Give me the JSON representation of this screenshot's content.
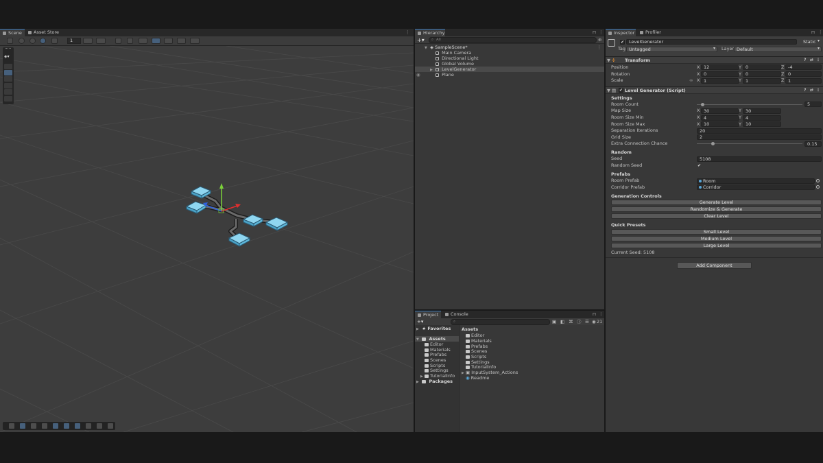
{
  "scene": {
    "tabs": [
      {
        "label": "Scene",
        "icon": "scene-icon"
      },
      {
        "label": "Asset Store",
        "icon": "asset-store-icon"
      }
    ],
    "grid_snap_value": "1"
  },
  "hierarchy": {
    "tab_label": "Hierarchy",
    "search_placeholder": "All",
    "items": [
      {
        "label": "SampleScene*",
        "icon": "unity-scene-icon"
      },
      {
        "label": "Main Camera",
        "icon": "gameobject-icon"
      },
      {
        "label": "Directional Light",
        "icon": "gameobject-icon"
      },
      {
        "label": "Global Volume",
        "icon": "gameobject-icon"
      },
      {
        "label": "LevelGenerator",
        "icon": "gameobject-icon"
      },
      {
        "label": "Plane",
        "icon": "gameobject-icon"
      }
    ]
  },
  "project": {
    "tabs": [
      "Project",
      "Console"
    ],
    "badge_count": "21",
    "sidebar": {
      "favorites": "Favorites",
      "assets": "Assets",
      "asset_folders": [
        "Editor",
        "Materials",
        "Prefabs",
        "Scenes",
        "Scripts",
        "Settings",
        "TutorialInfo"
      ],
      "packages": "Packages"
    },
    "breadcrumb": "Assets",
    "contents": [
      "Editor",
      "Materials",
      "Prefabs",
      "Scenes",
      "Scripts",
      "Settings",
      "TutorialInfo",
      "InputSystem_Actions",
      "Readme"
    ]
  },
  "inspector": {
    "tabs": [
      "Inspector",
      "Profiler"
    ],
    "object_name": "LevelGenerator",
    "static_label": "Static",
    "tag_label": "Tag",
    "tag_value": "Untagged",
    "layer_label": "Layer",
    "layer_value": "Default",
    "transform": {
      "title": "Transform",
      "position": {
        "label": "Position",
        "x": "12",
        "y": "0",
        "z": "-4"
      },
      "rotation": {
        "label": "Rotation",
        "x": "0",
        "y": "0",
        "z": "0"
      },
      "scale": {
        "label": "Scale",
        "x": "1",
        "y": "1",
        "z": "1"
      }
    },
    "script": {
      "title": "Level Generator (Script)",
      "settings_title": "Settings",
      "room_count": {
        "label": "Room Count",
        "value": "5",
        "fraction": 0.05
      },
      "map_size": {
        "label": "Map Size",
        "x": "30",
        "y": "30"
      },
      "room_size_min": {
        "label": "Room Size Min",
        "x": "4",
        "y": "4"
      },
      "room_size_max": {
        "label": "Room Size Max",
        "x": "10",
        "y": "10"
      },
      "separation_iterations": {
        "label": "Separation Iterations",
        "value": "20"
      },
      "grid_size": {
        "label": "Grid Size",
        "value": "2"
      },
      "extra_connection_chance": {
        "label": "Extra Connection Chance",
        "value": "0.15",
        "fraction": 0.15
      },
      "random_title": "Random",
      "seed": {
        "label": "Seed",
        "value": "5108"
      },
      "random_seed": {
        "label": "Random Seed",
        "checked": "✔"
      },
      "prefabs_title": "Prefabs",
      "room_prefab": {
        "label": "Room Prefab",
        "value": "Room"
      },
      "corridor_prefab": {
        "label": "Corridor Prefab",
        "value": "Corridor"
      },
      "generation_title": "Generation Controls",
      "generate_label": "Generate Level",
      "randomize_label": "Randomize & Generate",
      "clear_label": "Clear Level",
      "presets_title": "Quick Presets",
      "small_label": "Small Level",
      "medium_label": "Medium Level",
      "large_label": "Large Level",
      "current_seed": "Current Seed: 5108"
    },
    "add_component_label": "Add Component"
  },
  "colors": {
    "accent": "#3a79bb",
    "room_fill": "#8fd6f0",
    "selection_outline": "#f29a2e"
  }
}
